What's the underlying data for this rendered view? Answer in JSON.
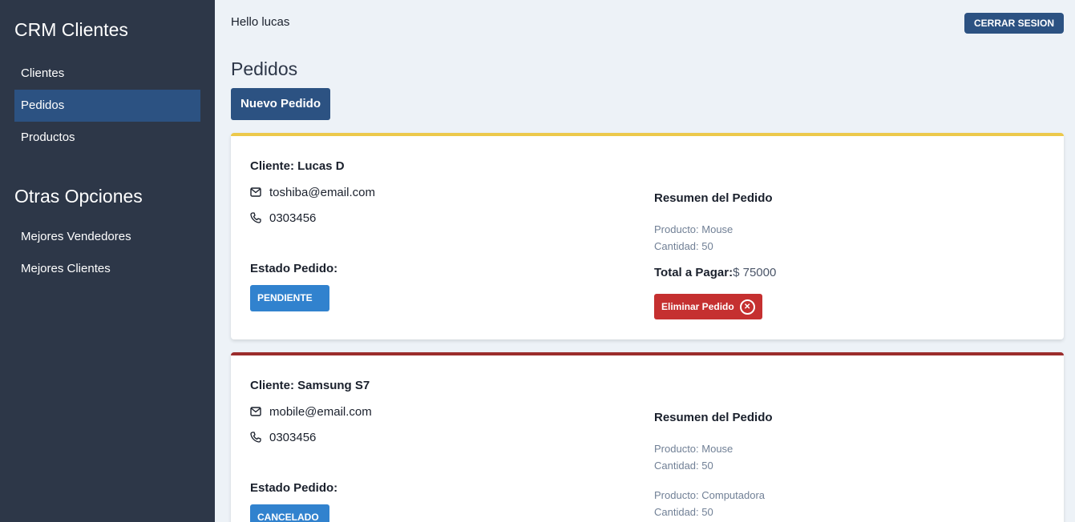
{
  "sidebar": {
    "brand": "CRM Clientes",
    "nav": [
      {
        "label": "Clientes"
      },
      {
        "label": "Pedidos"
      },
      {
        "label": "Productos"
      }
    ],
    "section_title": "Otras Opciones",
    "nav2": [
      {
        "label": "Mejores Vendedores"
      },
      {
        "label": "Mejores Clientes"
      }
    ]
  },
  "header": {
    "greeting": "Hello lucas",
    "logout_label": "CERRAR SESION"
  },
  "page": {
    "title": "Pedidos",
    "new_order_label": "Nuevo Pedido"
  },
  "orders": [
    {
      "client": "Cliente: Lucas D",
      "email": "toshiba@email.com",
      "phone": "0303456",
      "estado_label": "Estado Pedido:",
      "estado": "PENDIENTE",
      "accent": "#ecc94b",
      "resumen_label": "Resumen del Pedido",
      "items": [
        {
          "product": "Producto: Mouse",
          "qty": "Cantidad: 50"
        }
      ],
      "total_label": "Total a Pagar:",
      "total": "$ 75000",
      "delete_label": "Eliminar Pedido"
    },
    {
      "client": "Cliente: Samsung S7",
      "email": "mobile@email.com",
      "phone": "0303456",
      "estado_label": "Estado Pedido:",
      "estado": "CANCELADO",
      "accent": "#9b2c2c",
      "resumen_label": "Resumen del Pedido",
      "items": [
        {
          "product": "Producto: Mouse",
          "qty": "Cantidad: 50"
        },
        {
          "product": "Producto: Computadora",
          "qty": "Cantidad: 50"
        }
      ]
    }
  ],
  "colors": {
    "sidebar_bg": "#2d3748",
    "active_nav": "#2c5282",
    "primary": "#2c5282",
    "estado_button": "#3182ce",
    "delete": "#c53030"
  }
}
